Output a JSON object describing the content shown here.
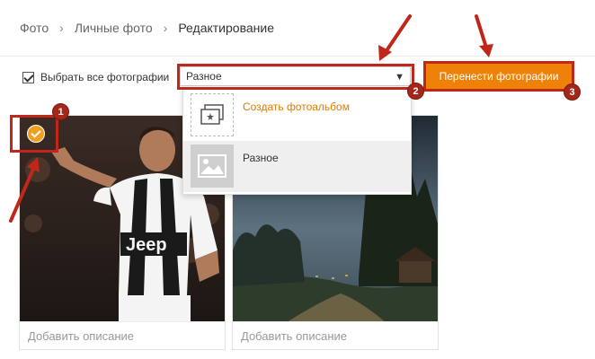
{
  "breadcrumb": {
    "items": [
      "Фото",
      "Личные фото",
      "Редактирование"
    ]
  },
  "toolbar": {
    "select_all_label": "Выбрать все фотографии",
    "select_all_checked": true,
    "dropdown_value": "Разное",
    "move_button_label": "Перенести фотографии"
  },
  "dropdown_menu": {
    "items": [
      {
        "label": "Создать фотоальбом",
        "icon": "create-album-icon"
      },
      {
        "label": "Разное",
        "icon": "album-cover-icon"
      }
    ]
  },
  "photos": [
    {
      "description_placeholder": "Добавить описание",
      "selected": true
    },
    {
      "description_placeholder": "Добавить описание",
      "selected": false
    }
  ],
  "annotations": {
    "badges": [
      "1",
      "2",
      "3"
    ]
  },
  "colors": {
    "accent": "#ee8208",
    "annotation_red": "#c0271b",
    "badge_red": "#a5261a",
    "check_orange": "#f0a020"
  }
}
